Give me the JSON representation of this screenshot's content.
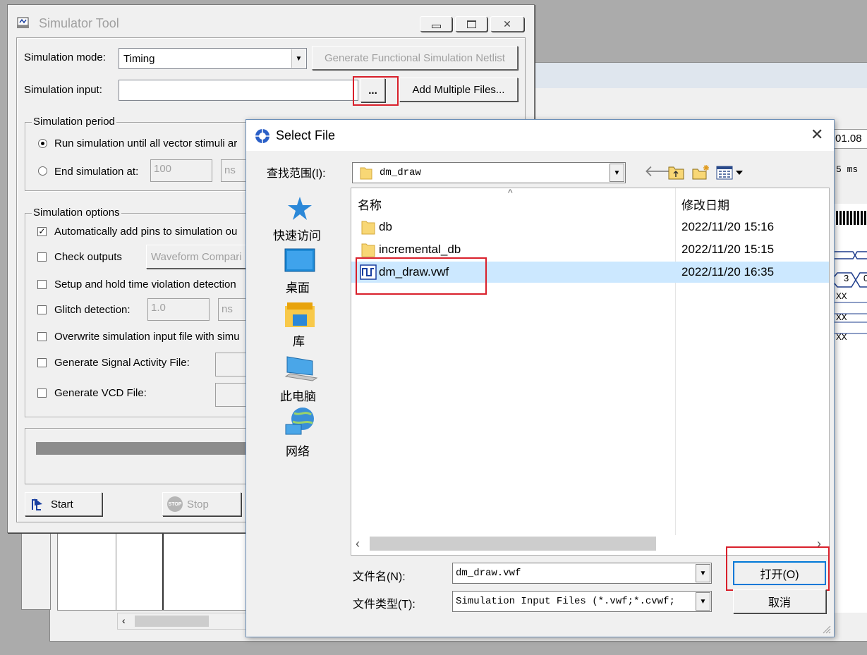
{
  "simulator": {
    "title": "Simulator Tool",
    "mode_label": "Simulation mode:",
    "mode_value": "Timing",
    "gen_netlist_button": "Generate Functional Simulation Netlist",
    "input_label": "Simulation input:",
    "input_value": "",
    "browse_button": "...",
    "add_multiple_button": "Add Multiple Files...",
    "period_group": "Simulation period",
    "run_until_label": "Run simulation until all vector stimuli ar",
    "end_at_label": "End simulation at:",
    "end_at_value": "100",
    "end_at_unit": "ns",
    "options_group": "Simulation options",
    "options": [
      {
        "label": "Automatically add pins to simulation ou",
        "checked": true
      },
      {
        "label": "Check outputs",
        "checked": false,
        "extra": "Waveform Compari"
      },
      {
        "label": "Setup and hold time violation detection",
        "checked": false
      },
      {
        "label": "Glitch detection:",
        "checked": false,
        "value": "1.0",
        "unit": "ns"
      },
      {
        "label": "Overwrite simulation input file with simu",
        "checked": false
      },
      {
        "label": "Generate Signal Activity File:",
        "checked": false
      },
      {
        "label": "Generate VCD File:",
        "checked": false
      }
    ],
    "start_button": "Start",
    "stop_button": "Stop"
  },
  "background": {
    "time_label": "01.08",
    "unit_label": "5 ms",
    "wave_value_3": "3",
    "wave_value_0": "0",
    "wave_xx": [
      "XX",
      "XX",
      "XX"
    ]
  },
  "dialog": {
    "title": "Select File",
    "look_in_label": "查找范围(I):",
    "look_in_value": "dm_draw",
    "places": [
      {
        "label": "快速访问",
        "icon": "star-icon"
      },
      {
        "label": "桌面",
        "icon": "desktop-icon"
      },
      {
        "label": "库",
        "icon": "library-icon"
      },
      {
        "label": "此电脑",
        "icon": "computer-icon"
      },
      {
        "label": "网络",
        "icon": "network-icon"
      }
    ],
    "columns": {
      "name": "名称",
      "date": "修改日期"
    },
    "files": [
      {
        "name": "db",
        "date": "2022/11/20 15:16",
        "type": "folder"
      },
      {
        "name": "incremental_db",
        "date": "2022/11/20 15:15",
        "type": "folder"
      },
      {
        "name": "dm_draw.vwf",
        "date": "2022/11/20 16:35",
        "type": "vwf",
        "selected": true
      }
    ],
    "filename_label": "文件名(N):",
    "filename_value": "dm_draw.vwf",
    "filetype_label": "文件类型(T):",
    "filetype_value": "Simulation Input Files (*.vwf;*.cvwf;",
    "open_button": "打开(O)",
    "cancel_button": "取消"
  },
  "colors": {
    "highlight": "#d9202b",
    "selection": "#cce8ff"
  }
}
